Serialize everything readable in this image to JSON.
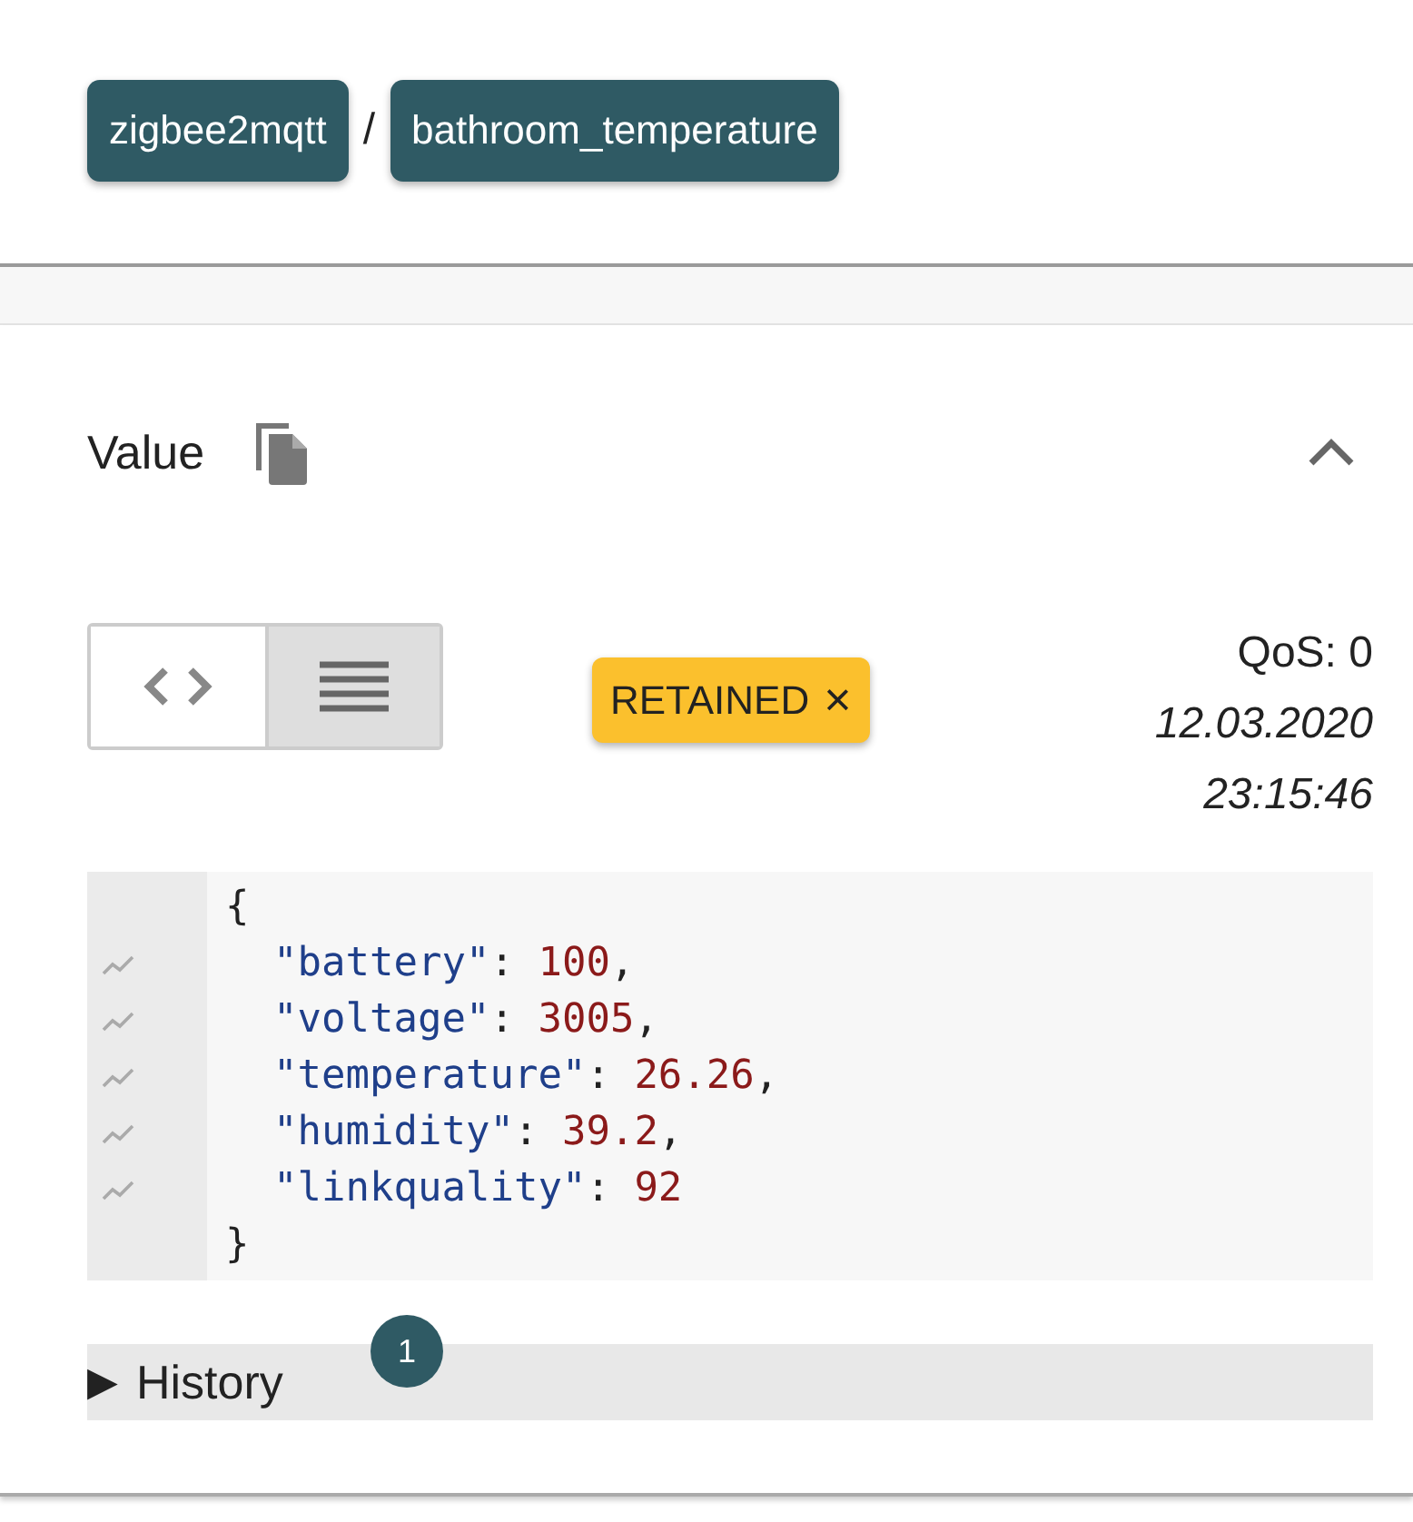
{
  "breadcrumb": {
    "items": [
      "zigbee2mqtt",
      "bathroom_temperature"
    ],
    "separator": "/"
  },
  "value_panel": {
    "title": "Value",
    "expanded": true,
    "view_toggle": [
      {
        "kind": "code",
        "selected": false
      },
      {
        "kind": "list",
        "selected": true
      }
    ],
    "retained_chip": {
      "label": "RETAINED",
      "mark": "×"
    },
    "qos": "QoS: 0",
    "date": "12.03.2020",
    "time": "23:15:46",
    "code": {
      "open": "{",
      "close": "}",
      "entries": [
        {
          "key": "\"battery\"",
          "colon": ": ",
          "value": "100",
          "comma": ","
        },
        {
          "key": "\"voltage\"",
          "colon": ": ",
          "value": "3005",
          "comma": ","
        },
        {
          "key": "\"temperature\"",
          "colon": ": ",
          "value": "26.26",
          "comma": ","
        },
        {
          "key": "\"humidity\"",
          "colon": ": ",
          "value": "39.2",
          "comma": ","
        },
        {
          "key": "\"linkquality\"",
          "colon": ": ",
          "value": "92"
        }
      ]
    },
    "history": {
      "marker": "▶",
      "label": "History",
      "count": "1",
      "expanded": false
    }
  }
}
